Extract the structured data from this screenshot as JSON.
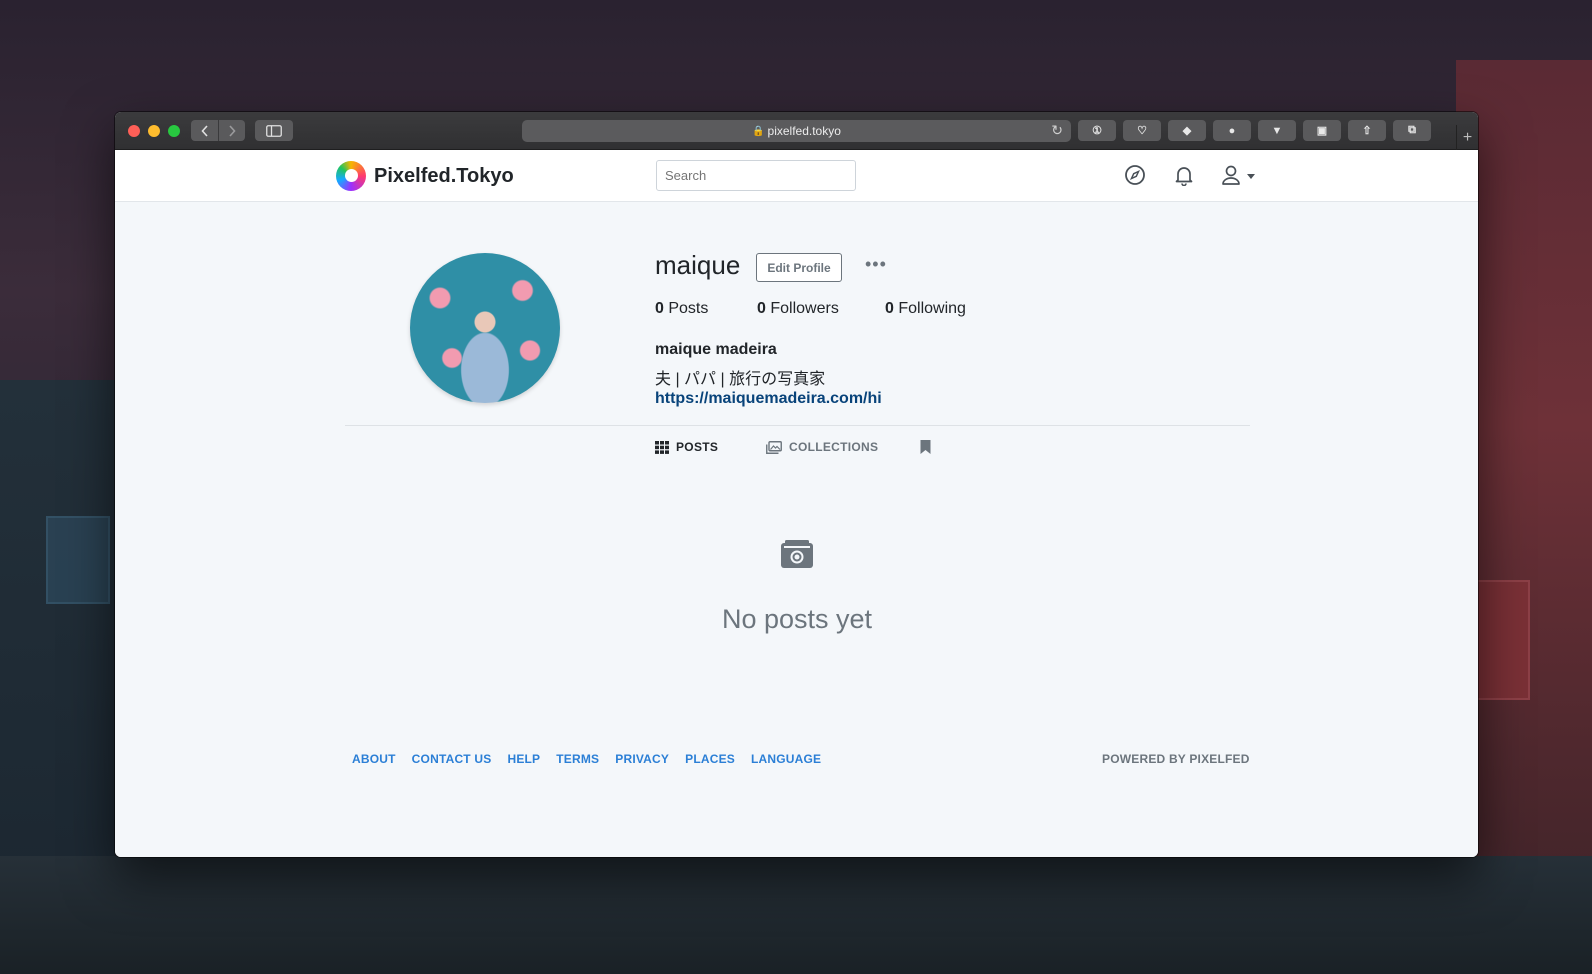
{
  "browser": {
    "url": "pixelfed.tokyo"
  },
  "site": {
    "brand": "Pixelfed.Tokyo",
    "search_placeholder": "Search"
  },
  "profile": {
    "username": "maique",
    "edit_label": "Edit Profile",
    "more_label": "•••",
    "stats": [
      {
        "count": "0",
        "label": "Posts"
      },
      {
        "count": "0",
        "label": "Followers"
      },
      {
        "count": "0",
        "label": "Following"
      }
    ],
    "full_name": "maique madeira",
    "bio": "夫 | パパ | 旅行の写真家",
    "link": "https://maiquemadeira.com/hi"
  },
  "tabs": {
    "posts": "POSTS",
    "collections": "COLLECTIONS"
  },
  "empty_state": {
    "text": "No posts yet"
  },
  "footer": {
    "links": [
      "ABOUT",
      "CONTACT US",
      "HELP",
      "TERMS",
      "PRIVACY",
      "PLACES",
      "LANGUAGE"
    ],
    "powered": "POWERED BY PIXELFED"
  },
  "colors": {
    "link": "#08437a",
    "footer_link": "#2b7fd6",
    "muted": "#6c757d"
  },
  "icons": {
    "compass": "compass-icon",
    "bell": "bell-icon",
    "user": "user-icon",
    "grid": "grid-icon",
    "collections": "images-icon",
    "bookmark": "bookmark-icon",
    "empty": "camera-icon"
  }
}
